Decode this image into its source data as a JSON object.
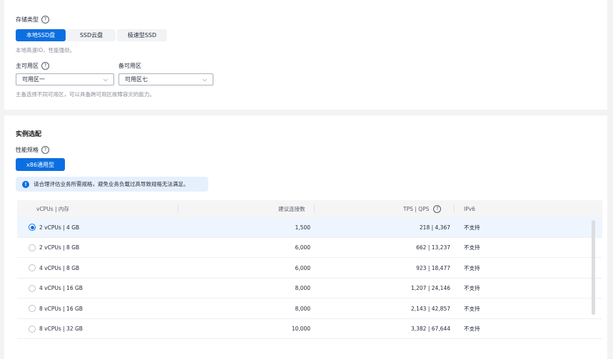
{
  "storage": {
    "label": "存储类型",
    "options": [
      "本地SSD盘",
      "SSD云盘",
      "极速型SSD"
    ],
    "selected_index": 0,
    "hint": "本地高速IO，性能强劲。"
  },
  "zones": {
    "primary_label": "主可用区",
    "primary_value": "可用区一",
    "standby_label": "备可用区",
    "standby_value": "可用区七",
    "hint": "主备选择不同可用区，可以具备跨可用区故障容灾的能力。"
  },
  "instance": {
    "title": "实例选配",
    "perf_label": "性能规格",
    "perf_option": "x86通用型",
    "alert": "请合理评估业务所需规格，避免业务负载过高导致规格无法满足。"
  },
  "table": {
    "headers": [
      "vCPUs | 内存",
      "建议连接数",
      "TPS | QPS",
      "IPv6"
    ],
    "rows": [
      {
        "spec": "2 vCPUs | 4 GB",
        "conn": "1,500",
        "tps": "218 | 4,367",
        "ipv6": "不支持",
        "selected": true
      },
      {
        "spec": "2 vCPUs | 8 GB",
        "conn": "6,000",
        "tps": "662 | 13,237",
        "ipv6": "不支持"
      },
      {
        "spec": "4 vCPUs | 8 GB",
        "conn": "6,000",
        "tps": "923 | 18,477",
        "ipv6": "不支持"
      },
      {
        "spec": "4 vCPUs | 16 GB",
        "conn": "8,000",
        "tps": "1,207 | 24,146",
        "ipv6": "不支持"
      },
      {
        "spec": "8 vCPUs | 16 GB",
        "conn": "8,000",
        "tps": "2,143 | 42,857",
        "ipv6": "不支持"
      },
      {
        "spec": "8 vCPUs | 32 GB",
        "conn": "10,000",
        "tps": "3,382 | 67,644",
        "ipv6": "不支持"
      }
    ]
  },
  "icons": {
    "help": "help-circle-icon",
    "info": "info-circle-icon",
    "chevron": "chevron-down-icon"
  },
  "colors": {
    "accent": "#0c6fe1",
    "alert_bg": "#e6f0fd",
    "page_bg": "#f2f3f5"
  }
}
